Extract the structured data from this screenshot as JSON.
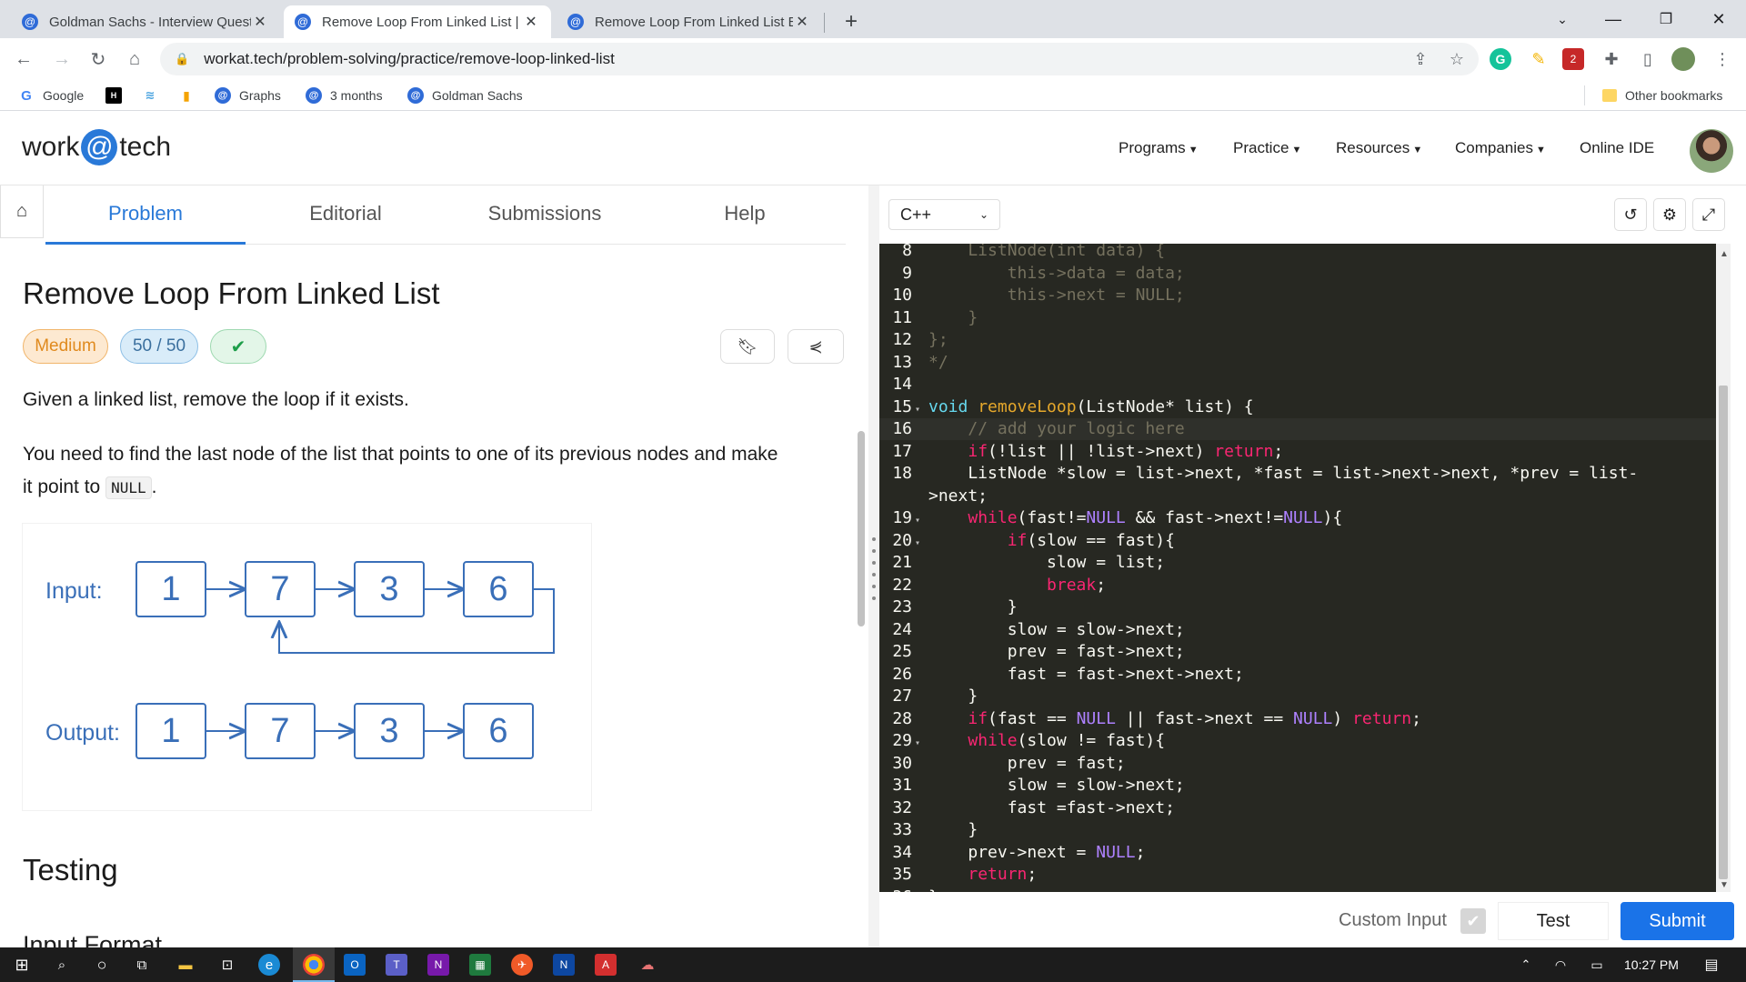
{
  "browser": {
    "tabs": [
      {
        "title": "Goldman Sachs - Interview Quest",
        "active": false
      },
      {
        "title": "Remove Loop From Linked List | I",
        "active": true
      },
      {
        "title": "Remove Loop From Linked List E",
        "active": false
      }
    ],
    "new_tab": "+",
    "url": "workat.tech/problem-solving/practice/remove-loop-linked-list",
    "bookmarks": [
      "Google",
      "Graphs",
      "3 months",
      "Goldman Sachs"
    ],
    "other_bookmarks": "Other bookmarks",
    "extension_badge": "2"
  },
  "site": {
    "logo_left": "work",
    "logo_at": "@",
    "logo_right": "tech",
    "nav": [
      "Programs",
      "Practice",
      "Resources",
      "Companies",
      "Online IDE"
    ]
  },
  "problem": {
    "tabs": [
      "Problem",
      "Editorial",
      "Submissions",
      "Help"
    ],
    "title": "Remove Loop From Linked List",
    "difficulty": "Medium",
    "score": "50 / 50",
    "desc1": "Given a linked list, remove the loop if it exists.",
    "desc2_a": "You need to find the last node of the list that points to one of its previous nodes and make",
    "desc2_b": "it point to ",
    "desc2_code": "NULL",
    "desc2_c": ".",
    "diagram": {
      "input_label": "Input:",
      "output_label": "Output:",
      "input_nodes": [
        "1",
        "7",
        "3",
        "6"
      ],
      "output_nodes": [
        "1",
        "7",
        "3",
        "6"
      ]
    },
    "testing_heading": "Testing",
    "input_format_heading": "Input Format"
  },
  "editor": {
    "language": "C++",
    "custom_input_label": "Custom Input",
    "test_label": "Test",
    "submit_label": "Submit",
    "lines": [
      {
        "n": "8",
        "fold": false,
        "tokens": [
          [
            "cm",
            "    ListNode(int data) {"
          ]
        ]
      },
      {
        "n": "9",
        "fold": false,
        "tokens": [
          [
            "cm",
            "        this->data = data;"
          ]
        ]
      },
      {
        "n": "10",
        "fold": false,
        "tokens": [
          [
            "cm",
            "        this->next = NULL;"
          ]
        ]
      },
      {
        "n": "11",
        "fold": false,
        "tokens": [
          [
            "cm",
            "    }"
          ]
        ]
      },
      {
        "n": "12",
        "fold": false,
        "tokens": [
          [
            "cm",
            "};"
          ]
        ]
      },
      {
        "n": "13",
        "fold": false,
        "tokens": [
          [
            "cm",
            "*/"
          ]
        ]
      },
      {
        "n": "14",
        "fold": false,
        "tokens": []
      },
      {
        "n": "15",
        "fold": true,
        "tokens": [
          [
            "ty",
            "void"
          ],
          [
            "tx",
            " "
          ],
          [
            "fn",
            "removeLoop"
          ],
          [
            "tx",
            "(ListNode* list) {"
          ]
        ]
      },
      {
        "n": "16",
        "fold": false,
        "active": true,
        "tokens": [
          [
            "tx",
            "    "
          ],
          [
            "cm",
            "// add your logic here"
          ]
        ]
      },
      {
        "n": "17",
        "fold": false,
        "tokens": [
          [
            "tx",
            "    "
          ],
          [
            "kw",
            "if"
          ],
          [
            "tx",
            "(!list || !list->next) "
          ],
          [
            "kw",
            "return"
          ],
          [
            "tx",
            ";"
          ]
        ]
      },
      {
        "n": "18",
        "fold": false,
        "tokens": [
          [
            "tx",
            "    ListNode *slow = list->next, *fast = list->next->next, *prev = list-"
          ]
        ]
      },
      {
        "n": "",
        "fold": false,
        "tokens": [
          [
            "tx",
            ">next;"
          ]
        ]
      },
      {
        "n": "19",
        "fold": true,
        "tokens": [
          [
            "tx",
            "    "
          ],
          [
            "kw",
            "while"
          ],
          [
            "tx",
            "(fast!="
          ],
          [
            "nl",
            "NULL"
          ],
          [
            "tx",
            " && fast->next!="
          ],
          [
            "nl",
            "NULL"
          ],
          [
            "tx",
            "){"
          ]
        ]
      },
      {
        "n": "20",
        "fold": true,
        "tokens": [
          [
            "tx",
            "        "
          ],
          [
            "kw",
            "if"
          ],
          [
            "tx",
            "(slow == fast){"
          ]
        ]
      },
      {
        "n": "21",
        "fold": false,
        "tokens": [
          [
            "tx",
            "            slow = list;"
          ]
        ]
      },
      {
        "n": "22",
        "fold": false,
        "tokens": [
          [
            "tx",
            "            "
          ],
          [
            "kw",
            "break"
          ],
          [
            "tx",
            ";"
          ]
        ]
      },
      {
        "n": "23",
        "fold": false,
        "tokens": [
          [
            "tx",
            "        }"
          ]
        ]
      },
      {
        "n": "24",
        "fold": false,
        "tokens": [
          [
            "tx",
            "        slow = slow->next;"
          ]
        ]
      },
      {
        "n": "25",
        "fold": false,
        "tokens": [
          [
            "tx",
            "        prev = fast->next;"
          ]
        ]
      },
      {
        "n": "26",
        "fold": false,
        "tokens": [
          [
            "tx",
            "        fast = fast->next->next;"
          ]
        ]
      },
      {
        "n": "27",
        "fold": false,
        "tokens": [
          [
            "tx",
            "    }"
          ]
        ]
      },
      {
        "n": "28",
        "fold": false,
        "tokens": [
          [
            "tx",
            "    "
          ],
          [
            "kw",
            "if"
          ],
          [
            "tx",
            "(fast == "
          ],
          [
            "nl",
            "NULL"
          ],
          [
            "tx",
            " || fast->next == "
          ],
          [
            "nl",
            "NULL"
          ],
          [
            "tx",
            ") "
          ],
          [
            "kw",
            "return"
          ],
          [
            "tx",
            ";"
          ]
        ]
      },
      {
        "n": "29",
        "fold": true,
        "tokens": [
          [
            "tx",
            "    "
          ],
          [
            "kw",
            "while"
          ],
          [
            "tx",
            "(slow != fast){"
          ]
        ]
      },
      {
        "n": "30",
        "fold": false,
        "tokens": [
          [
            "tx",
            "        prev = fast;"
          ]
        ]
      },
      {
        "n": "31",
        "fold": false,
        "tokens": [
          [
            "tx",
            "        slow = slow->next;"
          ]
        ]
      },
      {
        "n": "32",
        "fold": false,
        "tokens": [
          [
            "tx",
            "        fast =fast->next;"
          ]
        ]
      },
      {
        "n": "33",
        "fold": false,
        "tokens": [
          [
            "tx",
            "    }"
          ]
        ]
      },
      {
        "n": "34",
        "fold": false,
        "tokens": [
          [
            "tx",
            "    prev->next = "
          ],
          [
            "nl",
            "NULL"
          ],
          [
            "tx",
            ";"
          ]
        ]
      },
      {
        "n": "35",
        "fold": false,
        "tokens": [
          [
            "tx",
            "    "
          ],
          [
            "kw",
            "return"
          ],
          [
            "tx",
            ";"
          ]
        ]
      },
      {
        "n": "36",
        "fold": false,
        "tokens": [
          [
            "tx",
            "}"
          ]
        ]
      }
    ]
  },
  "taskbar": {
    "clock": "10:27 PM"
  },
  "colors": {
    "accent": "#2979d8",
    "submit": "#1a73e8",
    "medium_badge_bg": "#fde9d1",
    "medium_badge_text": "#e08a1e",
    "score_badge_bg": "#d9ecf9",
    "solved_badge_bg": "#e3f6e8",
    "editor_bg": "#272822"
  }
}
